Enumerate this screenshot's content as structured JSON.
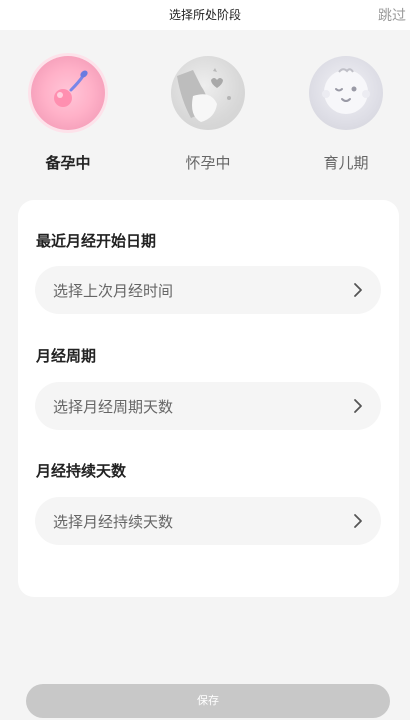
{
  "header": {
    "title": "选择所处阶段",
    "skip_label": "跳过"
  },
  "stages": [
    {
      "label": "备孕中",
      "icon": "sperm-egg-icon",
      "active": true
    },
    {
      "label": "怀孕中",
      "icon": "pregnant-belly-icon",
      "active": false
    },
    {
      "label": "育儿期",
      "icon": "baby-face-icon",
      "active": false
    }
  ],
  "form": {
    "fields": [
      {
        "title": "最近月经开始日期",
        "placeholder": "选择上次月经时间"
      },
      {
        "title": "月经周期",
        "placeholder": "选择月经周期天数"
      },
      {
        "title": "月经持续天数",
        "placeholder": "选择月经持续天数"
      }
    ]
  },
  "footer": {
    "save_label": "保存"
  },
  "colors": {
    "background": "#f4f4f4",
    "card": "#ffffff",
    "field": "#f5f5f5",
    "active_stage": "#f7a3bd",
    "disabled_button": "#c8c8c8"
  }
}
